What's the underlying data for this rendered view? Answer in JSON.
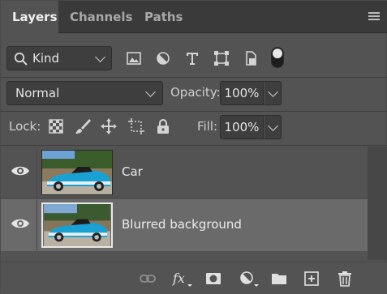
{
  "tabs": [
    {
      "label": "Layers",
      "active": true
    },
    {
      "label": "Channels",
      "active": false
    },
    {
      "label": "Paths",
      "active": false
    }
  ],
  "filter": {
    "kind_label": "Kind"
  },
  "blend": {
    "mode": "Normal",
    "opacity_label": "Opacity:",
    "opacity_value": "100%"
  },
  "lock": {
    "label": "Lock:",
    "fill_label": "Fill:",
    "fill_value": "100%"
  },
  "layers": [
    {
      "name": "Car",
      "visible": true,
      "selected": false
    },
    {
      "name": "Blurred background",
      "visible": true,
      "selected": true
    }
  ],
  "colors": {
    "accent_car": "#1aa1d4",
    "panel_bg": "#535353",
    "selected_row": "#6a6a6a"
  }
}
